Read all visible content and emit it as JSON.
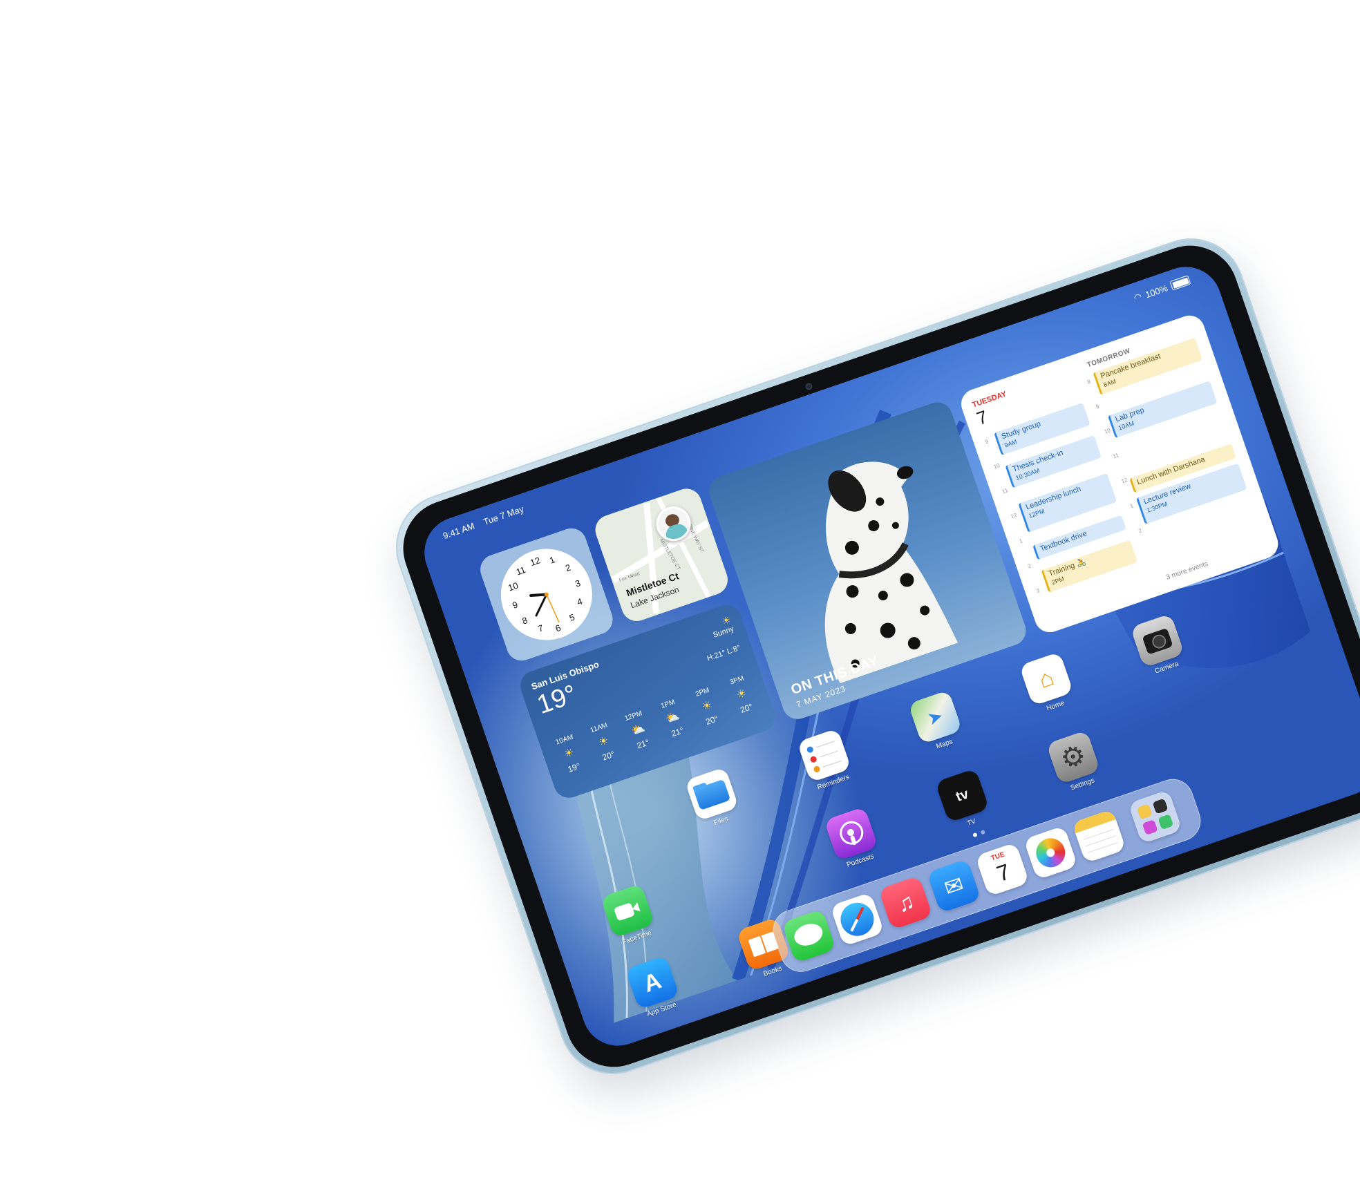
{
  "status_bar": {
    "time": "9:41 AM",
    "date": "Tue 7 May",
    "battery": "100%"
  },
  "clock_widget": {
    "numbers": [
      "12",
      "1",
      "2",
      "3",
      "4",
      "5",
      "6",
      "7",
      "8",
      "9",
      "10",
      "11"
    ]
  },
  "map_widget": {
    "place": "Mistletoe Ct",
    "area": "Lake Jackson",
    "street_labels": [
      "MISTLETOE CT",
      "PINE WAY ST",
      "Fox Mead"
    ]
  },
  "photo_widget": {
    "title": "ON THIS DAY",
    "date": "7 MAY 2023"
  },
  "calendar_widget": {
    "today_name": "TUESDAY",
    "today_number": "7",
    "tomorrow_label": "TOMORROW",
    "hours_left": [
      "9",
      "10",
      "11",
      "12",
      "1",
      "2",
      "3"
    ],
    "hours_right": [
      "8",
      "9",
      "10",
      "11",
      "12",
      "1",
      "2"
    ],
    "today_events": [
      {
        "title": "Study group",
        "time": "9AM",
        "color": "blue"
      },
      {
        "title": "Thesis check-in",
        "time": "10:30AM",
        "color": "blue"
      },
      {
        "title": "Leadership lunch",
        "time": "12PM",
        "color": "blue"
      },
      {
        "title": "Textbook drive",
        "time": "",
        "color": "blue"
      },
      {
        "title": "Training 🚴",
        "time": "2PM",
        "color": "yellow"
      }
    ],
    "tomorrow_events": [
      {
        "title": "Pancake breakfast",
        "time": "8AM",
        "color": "yellow"
      },
      {
        "title": "Lab prep",
        "time": "10AM",
        "color": "blue"
      },
      {
        "title": "Lunch with Darshana",
        "time": "",
        "color": "yellow"
      },
      {
        "title": "Lecture review",
        "time": "1:30PM",
        "color": "blue"
      }
    ],
    "more": "3 more events"
  },
  "weather_widget": {
    "city": "San Luis Obispo",
    "temp": "19°",
    "condition": "Sunny",
    "high_low": "H:21° L:8°",
    "hours": [
      {
        "time": "10AM",
        "icon": "sun-icon",
        "temp": "19°"
      },
      {
        "time": "11AM",
        "icon": "sun-icon",
        "temp": "20°"
      },
      {
        "time": "12PM",
        "icon": "partly-sunny-icon",
        "temp": "21°"
      },
      {
        "time": "1PM",
        "icon": "partly-sunny-icon",
        "temp": "21°"
      },
      {
        "time": "2PM",
        "icon": "sun-icon",
        "temp": "20°"
      },
      {
        "time": "3PM",
        "icon": "sun-icon",
        "temp": "20°"
      }
    ]
  },
  "apps": {
    "files": "Files",
    "reminders": "Reminders",
    "maps": "Maps",
    "home": "Home",
    "camera": "Camera",
    "facetime": "FaceTime",
    "podcasts": "Podcasts",
    "tv": "TV",
    "settings": "Settings",
    "books": "Books",
    "app_store": "App Store"
  },
  "dock": {
    "calendar_day": "TUE",
    "calendar_num": "7"
  },
  "colors": {
    "screen_blue": "#3f73d4",
    "calendar_red": "#e5322d",
    "event_blue": "#2f86e8",
    "event_yellow": "#e3b313"
  }
}
